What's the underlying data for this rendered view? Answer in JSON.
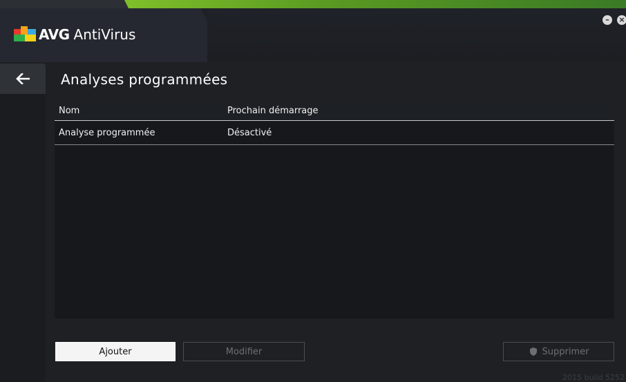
{
  "app": {
    "brand": "AVG",
    "product": "AntiVirus",
    "build": "2015  build 5252"
  },
  "window_controls": {
    "minimize_icon": "minus-icon",
    "close_icon": "close-icon"
  },
  "navigation": {
    "back_icon": "back-arrow-icon"
  },
  "page": {
    "title": "Analyses programmées"
  },
  "table": {
    "columns": [
      "Nom",
      "Prochain démarrage"
    ],
    "rows": [
      {
        "name": "Analyse programmée",
        "next_start": "Désactivé"
      }
    ]
  },
  "buttons": {
    "add": "Ajouter",
    "edit": "Modifier",
    "delete": "Supprimer",
    "delete_icon": "shield-icon"
  },
  "colors": {
    "accent_green": "#7fbf2a",
    "background": "#1e2024"
  }
}
